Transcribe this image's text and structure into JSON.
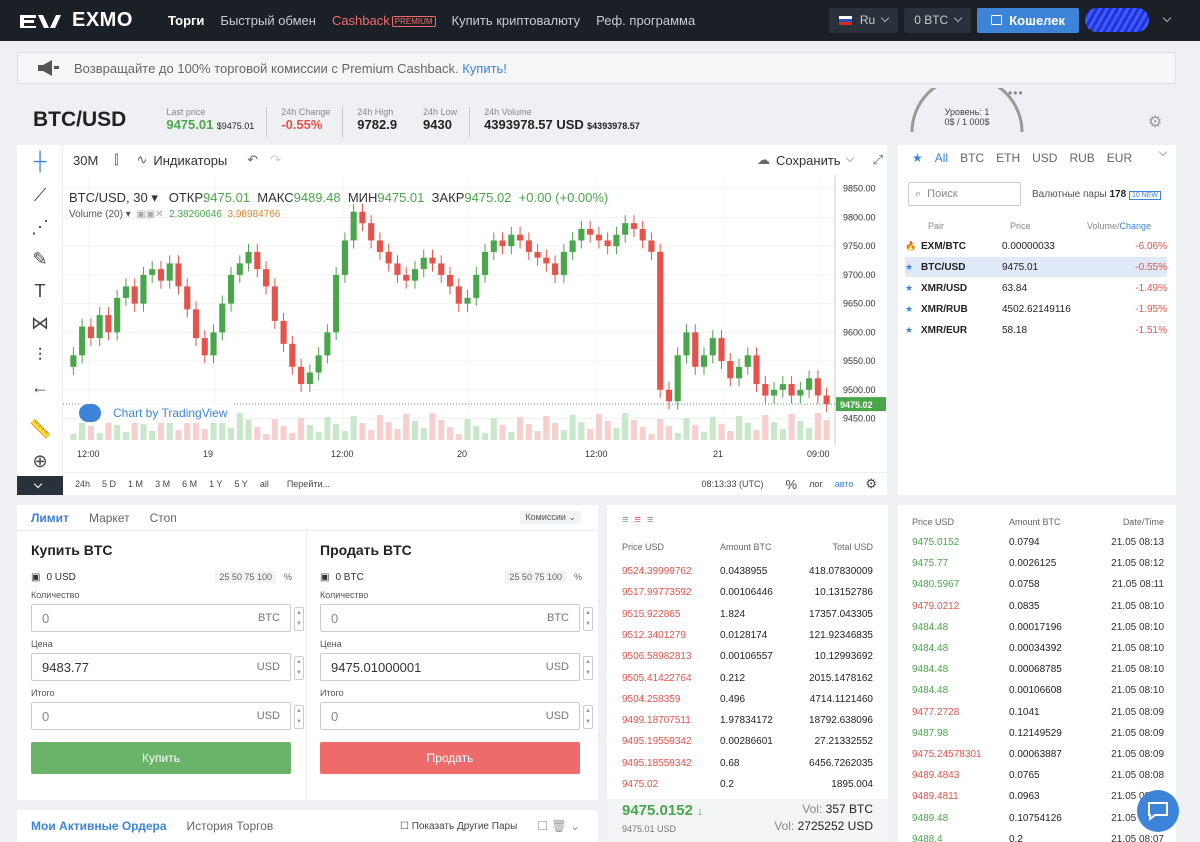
{
  "nav": {
    "logo": "EXMO",
    "items": [
      "Торги",
      "Быстрый обмен",
      "Cashback",
      "Купить криптовалюту",
      "Реф. программа"
    ],
    "premium_badge": "PREMIUM",
    "lang": "Ru",
    "balance": "0 BTC",
    "wallet": "Кошелек"
  },
  "banner": {
    "text": "Возвращайте до 100% торговой комиссии с Premium Cashback.",
    "link": "Купить!"
  },
  "ticker": {
    "pair": "BTC/USD",
    "last_price_label": "Last price",
    "last_price": "9475.01",
    "last_price_usd": "$9475.01",
    "change_label": "24h Change",
    "change": "-0.55%",
    "high_label": "24h High",
    "high": "9782.9",
    "low_label": "24h Low",
    "low": "9430",
    "volume_label": "24h Volume",
    "volume": "4393978.57 USD",
    "volume_usd": "$4393978.57",
    "level_label": "Уровень: 1",
    "level_value": "0$ / 1 000$"
  },
  "chart_toolbar": {
    "interval": "30M",
    "indicators": "Индикаторы",
    "save": "Сохранить"
  },
  "chart_legend": {
    "symbol": "BTC/USD, 30",
    "open_label": "ОТКР",
    "open": "9475.01",
    "high_label": "МАКС",
    "high": "9489.48",
    "low_label": "МИН",
    "low": "9475.01",
    "close_label": "ЗАКР",
    "close": "9475.02",
    "change": "+0.00 (+0.00%)",
    "volume_label": "Volume (20)",
    "volume_v1": "2.38260646",
    "volume_v2": "3.98984766",
    "tv_badge": "Chart by TradingView"
  },
  "chart_data": {
    "type": "candlestick",
    "y_ticks": [
      "9850.00",
      "9800.00",
      "9750.00",
      "9700.00",
      "9650.00",
      "9600.00",
      "9550.00",
      "9500.00",
      "9450.00"
    ],
    "ylim": [
      9430,
      9860
    ],
    "x_ticks": [
      "12:00",
      "19",
      "12:00",
      "20",
      "12:00",
      "21",
      "09:00"
    ],
    "last_price": "9475.02",
    "closes": [
      9560,
      9610,
      9590,
      9630,
      9600,
      9660,
      9680,
      9650,
      9700,
      9710,
      9690,
      9720,
      9680,
      9640,
      9590,
      9560,
      9600,
      9650,
      9700,
      9720,
      9740,
      9710,
      9680,
      9620,
      9580,
      9540,
      9510,
      9530,
      9560,
      9600,
      9700,
      9760,
      9810,
      9790,
      9760,
      9740,
      9720,
      9700,
      9690,
      9710,
      9730,
      9720,
      9700,
      9680,
      9650,
      9660,
      9700,
      9740,
      9760,
      9750,
      9770,
      9760,
      9740,
      9730,
      9720,
      9700,
      9740,
      9760,
      9780,
      9770,
      9760,
      9750,
      9770,
      9790,
      9780,
      9760,
      9740,
      9500,
      9480,
      9560,
      9600,
      9540,
      9560,
      9590,
      9550,
      9520,
      9540,
      9560,
      9510,
      9490,
      9500,
      9510,
      9490,
      9500,
      9520,
      9490,
      9475
    ],
    "time_ranges": [
      "24h",
      "5 D",
      "1 M",
      "3 M",
      "6 M",
      "1 Y",
      "5 Y",
      "all"
    ],
    "goto": "Перейти...",
    "clock": "08:13:33 (UTC)",
    "pct": "%",
    "log": "лог",
    "auto": "авто"
  },
  "pairs_panel": {
    "tabs": [
      "All",
      "BTC",
      "ETH",
      "USD",
      "RUB",
      "EUR"
    ],
    "search_placeholder": "Поиск",
    "count_label": "Валютные пары",
    "count": "178",
    "new_badge": "10 NEW",
    "col_pair": "Pair",
    "col_price": "Price",
    "col_vol": "Volume/",
    "col_change": "Change",
    "rows": [
      {
        "pair": "EXM/BTC",
        "price": "0.00000033",
        "change": "-6.06%"
      },
      {
        "pair": "BTC/USD",
        "price": "9475.01",
        "change": "-0.55%"
      },
      {
        "pair": "XMR/USD",
        "price": "63.84",
        "change": "-1.49%"
      },
      {
        "pair": "XMR/RUB",
        "price": "4502.62149116",
        "change": "-1.95%"
      },
      {
        "pair": "XMR/EUR",
        "price": "58.18",
        "change": "-1.51%"
      }
    ]
  },
  "order_form": {
    "tabs": [
      "Лимит",
      "Маркет",
      "Стоп"
    ],
    "commission": "Комиссии",
    "buy_title": "Купить BTC",
    "sell_title": "Продать BTC",
    "buy_balance": "0 USD",
    "sell_balance": "0 BTC",
    "pct_options": "25  50  75  100",
    "pct_sign": "%",
    "qty_label": "Количество",
    "price_label": "Цена",
    "total_label": "Итого",
    "zero": "0",
    "buy_price": "9483.77",
    "sell_price": "9475.01000001",
    "btc": "BTC",
    "usd": "USD",
    "buy_btn": "Купить",
    "sell_btn": "Продать"
  },
  "my_orders": {
    "active": "Мои Активные Ордера",
    "history": "История Торгов",
    "show_other": "Показать Другие Пары"
  },
  "orderbook": {
    "col_price": "Price USD",
    "col_amount": "Amount BTC",
    "col_total": "Total USD",
    "rows": [
      [
        "9524.39999762",
        "0.0438955",
        "418.07830009"
      ],
      [
        "9517.99773592",
        "0.00106446",
        "10.13152786"
      ],
      [
        "9515.922865",
        "1.824",
        "17357.043305"
      ],
      [
        "9512.3401279",
        "0.0128174",
        "121.92346835"
      ],
      [
        "9506.58982813",
        "0.00106557",
        "10.12993692"
      ],
      [
        "9505.41422764",
        "0.212",
        "2015.1478162"
      ],
      [
        "9504.258359",
        "0.496",
        "4714.1121460"
      ],
      [
        "9499.18707511",
        "1.97834172",
        "18792.638096"
      ],
      [
        "9495.19559342",
        "0.00286601",
        "27.21332552"
      ],
      [
        "9495.18559342",
        "0.68",
        "6456.7262035"
      ],
      [
        "9475.02",
        "0.2",
        "1895.004"
      ]
    ],
    "last": "9475.0152",
    "last_usd": "9475.01 USD",
    "vol_btc_label": "Vol:",
    "vol_btc": "357 BTC",
    "vol_usd_label": "Vol:",
    "vol_usd": "2725252 USD"
  },
  "trades": {
    "col_price": "Price USD",
    "col_amount": "Amount BTC",
    "col_time": "Date/Time",
    "rows": [
      {
        "p": "9475.0152",
        "a": "0.0794",
        "t": "21.05 08:13",
        "s": "buy"
      },
      {
        "p": "9475.77",
        "a": "0.0026125",
        "t": "21.05 08:12",
        "s": "buy"
      },
      {
        "p": "9480.5967",
        "a": "0.0758",
        "t": "21.05 08:11",
        "s": "buy"
      },
      {
        "p": "9479.0212",
        "a": "0.0835",
        "t": "21.05 08:10",
        "s": "sell"
      },
      {
        "p": "9484.48",
        "a": "0.00017196",
        "t": "21.05 08:10",
        "s": "buy"
      },
      {
        "p": "9484.48",
        "a": "0.00034392",
        "t": "21.05 08:10",
        "s": "buy"
      },
      {
        "p": "9484.48",
        "a": "0.00068785",
        "t": "21.05 08:10",
        "s": "buy"
      },
      {
        "p": "9484.48",
        "a": "0.00106608",
        "t": "21.05 08:10",
        "s": "buy"
      },
      {
        "p": "9477.2728",
        "a": "0.1041",
        "t": "21.05 08:09",
        "s": "sell"
      },
      {
        "p": "9487.98",
        "a": "0.12149529",
        "t": "21.05 08:09",
        "s": "buy"
      },
      {
        "p": "9475.24578301",
        "a": "0.00063887",
        "t": "21.05 08:09",
        "s": "sell"
      },
      {
        "p": "9489.4843",
        "a": "0.0765",
        "t": "21.05 08:08",
        "s": "sell"
      },
      {
        "p": "9489.4811",
        "a": "0.0963",
        "t": "21.05 08:07",
        "s": "sell"
      },
      {
        "p": "9489.48",
        "a": "0.10754126",
        "t": "21.05 08:07",
        "s": "buy"
      },
      {
        "p": "9488.4",
        "a": "0.2",
        "t": "21.05 08:07",
        "s": "buy"
      }
    ]
  },
  "colors": {
    "buy": "#4aa64a",
    "sell": "#e5534b",
    "accent": "#3d84d8"
  }
}
